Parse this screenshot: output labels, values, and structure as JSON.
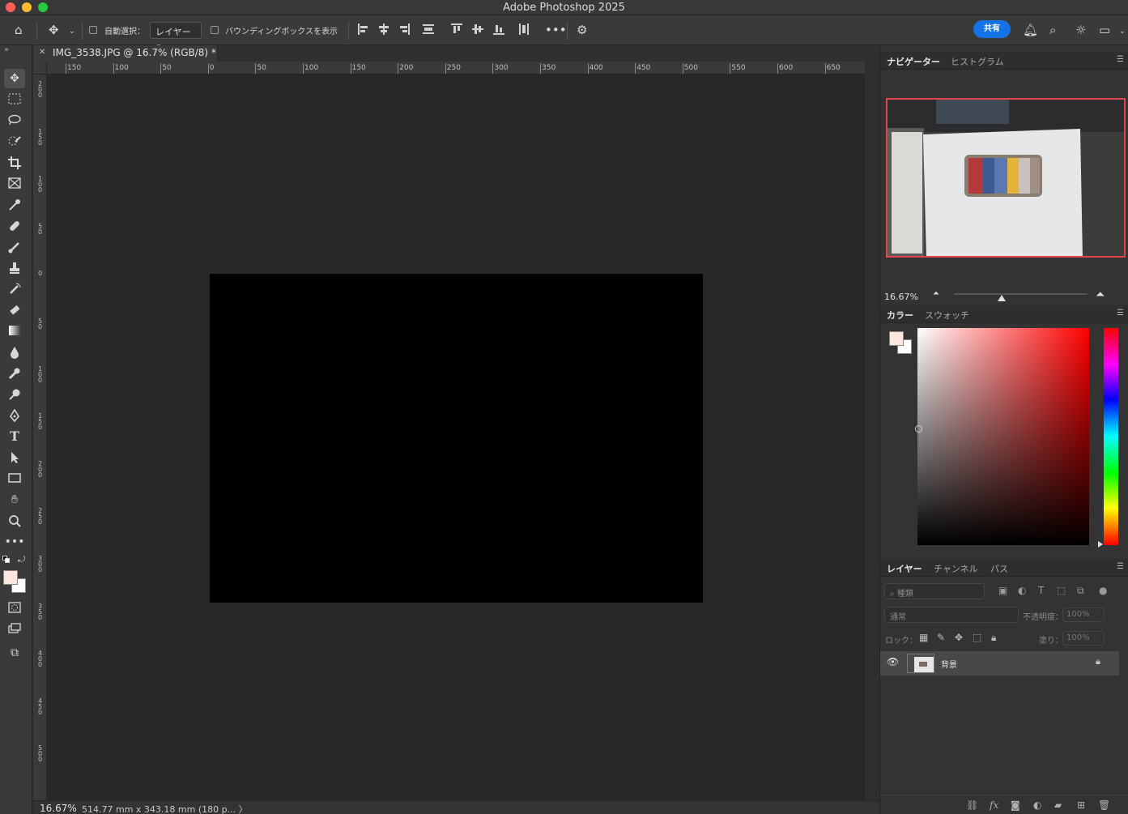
{
  "window": {
    "title": "Adobe Photoshop 2025"
  },
  "options_bar": {
    "auto_select_label": "自動選択：",
    "layer_select_value": "レイヤー",
    "bounding_box_label": "バウンディングボックスを表示",
    "share_label": "共有"
  },
  "document": {
    "tab_title": "IMG_3538.JPG @ 16.7% (RGB/8) *"
  },
  "rulers": {
    "top_labels": [
      "150",
      "100",
      "50",
      "0",
      "50",
      "100",
      "150",
      "200",
      "250",
      "300",
      "350",
      "400",
      "450",
      "500",
      "550",
      "600",
      "650"
    ],
    "left_labels": [
      "200",
      "150",
      "100",
      "50",
      "0",
      "50",
      "100",
      "150",
      "200",
      "250",
      "300",
      "350",
      "400",
      "450",
      "500"
    ]
  },
  "status_bar": {
    "zoom": "16.67%",
    "info": "514.77 mm x 343.18 mm (180 p... 〉"
  },
  "navigator": {
    "tabs": [
      "ナビゲーター",
      "ヒストグラム"
    ],
    "zoom": "16.67%"
  },
  "color_panel": {
    "tabs": [
      "カラー",
      "スウォッチ"
    ],
    "foreground": "#fde6de",
    "background": "#ffffff"
  },
  "layers_panel": {
    "tabs": [
      "レイヤー",
      "チャンネル",
      "パス"
    ],
    "search_placeholder": "種類",
    "blend_mode": "通常",
    "opacity_label": "不透明度：",
    "opacity_value": "100%",
    "lock_label": "ロック：",
    "fill_label": "塗り：",
    "fill_value": "100%",
    "layers": [
      {
        "name": "背景"
      }
    ]
  },
  "colors": {
    "accent": "#1473e6",
    "navigator_frame": "#e2464d"
  }
}
